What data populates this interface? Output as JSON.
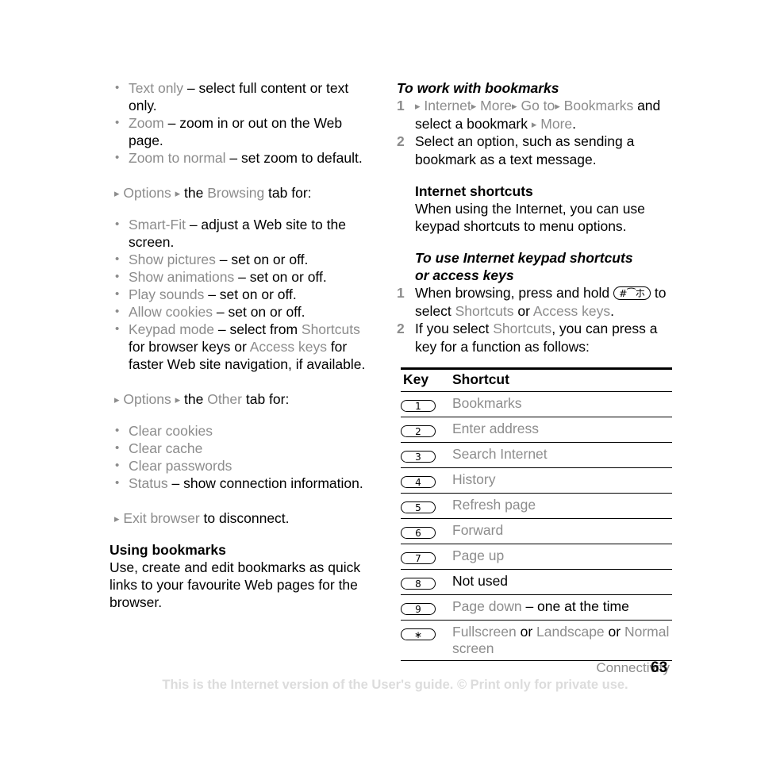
{
  "left_column": {
    "bullets_content": [
      {
        "term": "Text only",
        "rest": " – select full content or text only."
      },
      {
        "term": "Zoom",
        "rest": " – zoom in or out on the Web page."
      },
      {
        "term": "Zoom to normal",
        "rest": " – set zoom to default."
      }
    ],
    "options_browsing": {
      "arrow1": "▸",
      "label": "Options",
      "arrow2": "▸",
      "mid": "the ",
      "tab": "Browsing",
      "tail": " tab for:"
    },
    "bullets_browsing": [
      {
        "term": "Smart-Fit",
        "rest": " – adjust a Web site to the screen."
      },
      {
        "term": "Show pictures",
        "rest": " – set on or off."
      },
      {
        "term": "Show animations",
        "rest": " – set on or off."
      },
      {
        "term": "Play sounds",
        "rest": " – set on or off."
      },
      {
        "term": "Allow cookies",
        "rest": " – set on or off."
      }
    ],
    "keypad_mode": {
      "term": "Keypad mode",
      "part1": " – select from ",
      "term2": "Shortcuts",
      "part2": " for browser keys or ",
      "term3": "Access keys",
      "part3": " for faster Web site navigation, if available."
    },
    "options_other": {
      "arrow1": "▸",
      "label": "Options",
      "arrow2": "▸",
      "mid": "the ",
      "tab": "Other",
      "tail": " tab for:"
    },
    "bullets_other": [
      {
        "term": "Clear cookies",
        "rest": ""
      },
      {
        "term": "Clear cache",
        "rest": ""
      },
      {
        "term": "Clear passwords",
        "rest": ""
      },
      {
        "term": "Status",
        "rest": " – show connection information."
      }
    ],
    "exit_browser": {
      "arrow": "▸",
      "label": "Exit browser",
      "tail": " to disconnect."
    },
    "using_bookmarks": {
      "heading": "Using bookmarks",
      "body": "Use, create and edit bookmarks as quick links to your favourite Web pages for the browser."
    }
  },
  "right_column": {
    "proc_bookmarks": {
      "heading": "To work with bookmarks",
      "step1": {
        "num": "1",
        "a1": "▸",
        "t1": "Internet",
        "a2": "▸",
        "t2": "More",
        "a3": "▸",
        "t3": "Go to",
        "a4": "▸",
        "t4": "Bookmarks",
        "mid": " and select a bookmark ",
        "a5": "▸",
        "t5": "More",
        "end": "."
      },
      "step2": {
        "num": "2",
        "text": "Select an option, such as sending a bookmark as a text message."
      }
    },
    "internet_shortcuts": {
      "heading": "Internet shortcuts",
      "body": "When using the Internet, you can use keypad shortcuts to menu options."
    },
    "proc_keypad": {
      "heading_line1": "To use Internet keypad shortcuts",
      "heading_line2": "or access keys",
      "step1": {
        "num": "1",
        "pre": "When browsing, press and hold ",
        "key_glyph": "#⁀ホ",
        "post_line": " to select ",
        "t1": "Shortcuts",
        "mid": " or ",
        "t2": "Access keys",
        "end": "."
      },
      "step2": {
        "num": "2",
        "pre": "If you select ",
        "t1": "Shortcuts",
        "post": ", you can press a key for a function as follows:"
      }
    }
  },
  "shortcut_table": {
    "headers": [
      "Key",
      "Shortcut"
    ],
    "rows": [
      {
        "key": "1",
        "shortcut": "Bookmarks",
        "shortcut_tail": "",
        "shortcut2": "",
        "shortcut3": ""
      },
      {
        "key": "2",
        "shortcut": "Enter address",
        "shortcut_tail": "",
        "shortcut2": "",
        "shortcut3": ""
      },
      {
        "key": "3",
        "shortcut": "Search Internet",
        "shortcut_tail": "",
        "shortcut2": "",
        "shortcut3": ""
      },
      {
        "key": "4",
        "shortcut": "History",
        "shortcut_tail": "",
        "shortcut2": "",
        "shortcut3": ""
      },
      {
        "key": "5",
        "shortcut": "Refresh page",
        "shortcut_tail": "",
        "shortcut2": "",
        "shortcut3": ""
      },
      {
        "key": "6",
        "shortcut": "Forward",
        "shortcut_tail": "",
        "shortcut2": "",
        "shortcut3": ""
      },
      {
        "key": "7",
        "shortcut": "Page up",
        "shortcut_tail": "",
        "shortcut2": "",
        "shortcut3": ""
      },
      {
        "key": "8",
        "shortcut": "",
        "shortcut_tail": "Not used",
        "shortcut2": "",
        "shortcut3": ""
      },
      {
        "key": "9",
        "shortcut": "Page down",
        "shortcut_tail": " – one at the time",
        "shortcut2": "",
        "shortcut3": ""
      },
      {
        "key": "∗",
        "shortcut": "Fullscreen",
        "shortcut_tail": " or ",
        "shortcut2": "Landscape",
        "shortcut_tail2": " or ",
        "shortcut3": "Normal screen"
      }
    ]
  },
  "footer": {
    "running_head": "Connectivity",
    "page_number": "63",
    "notice": "This is the Internet version of the User's guide. © Print only for private use."
  },
  "colors": {
    "gray_text": "#8c8c8c",
    "black_text": "#000000",
    "footer_notice": "#dcdcdc",
    "page_bg": "#ffffff"
  }
}
